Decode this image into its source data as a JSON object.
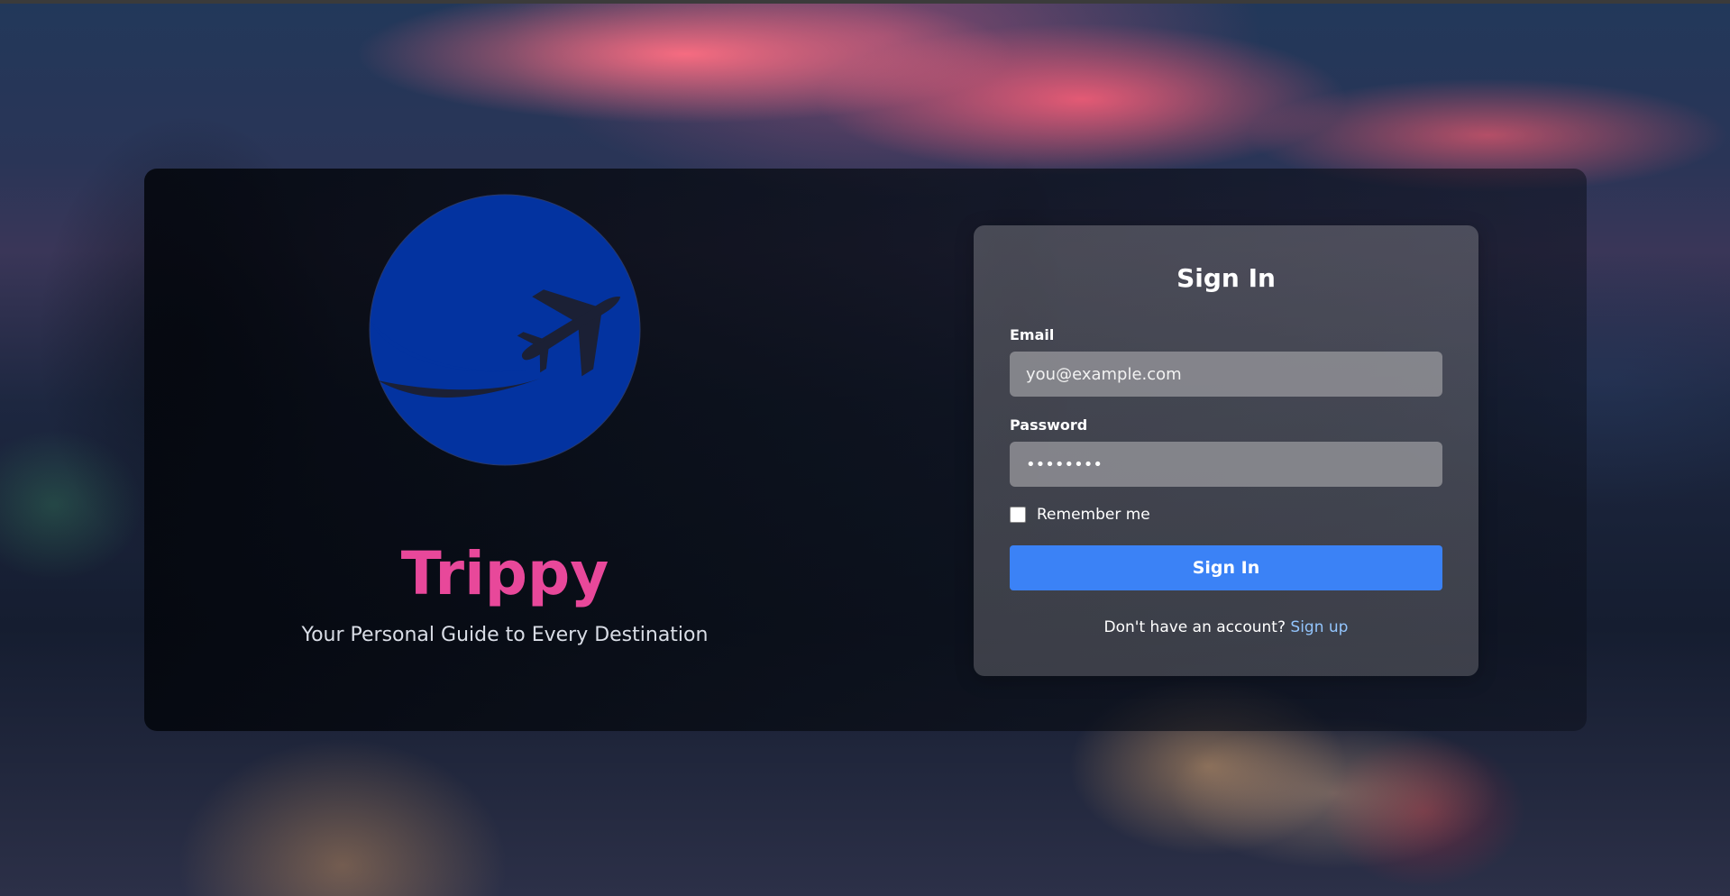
{
  "brand": {
    "title": "Trippy",
    "tagline": "Your Personal Guide to Every Destination",
    "logo_icon": "airplane-globe-icon",
    "title_color": "#e8489a",
    "logo_color": "#0333a0"
  },
  "signin": {
    "title": "Sign In",
    "email_label": "Email",
    "email_placeholder": "you@example.com",
    "password_label": "Password",
    "password_value": "••••••••",
    "remember_label": "Remember me",
    "remember_checked": false,
    "button_label": "Sign In",
    "no_account_text": "Don't have an account?",
    "signup_link": "Sign up",
    "button_color": "#3b82f6",
    "link_color": "#93c5fd"
  }
}
